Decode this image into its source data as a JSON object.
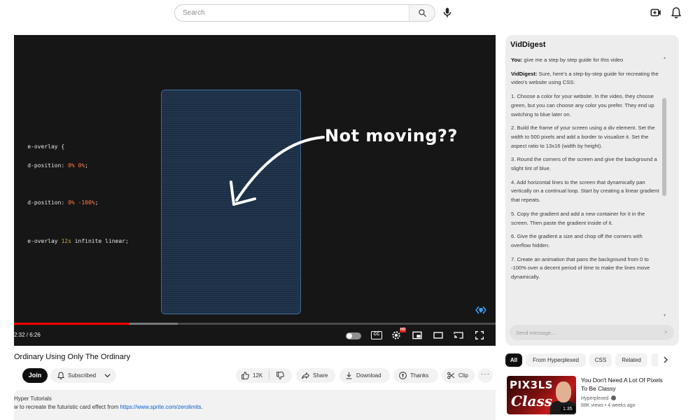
{
  "header": {
    "search_placeholder": "Search",
    "icons": [
      "search-icon",
      "mic-icon",
      "create-icon",
      "notifications-icon"
    ]
  },
  "player": {
    "code_lines": [
      {
        "selector": "e-overlay {"
      },
      {
        "prop": "d-position: ",
        "value": "0% 0%",
        "end": ";"
      },
      {
        "prop": "d-position: ",
        "value": "0% -100%",
        "end": ";"
      },
      {
        "prop": "e-overlay ",
        "value": "12s",
        "rest": " infinite linear;"
      }
    ],
    "overlay_text": "Not moving??",
    "time": "2:32 / 6:26",
    "progress_fraction": 0.24,
    "buffer_fraction": 0.34,
    "hd_badge": "HD",
    "cc_label": "CC"
  },
  "video": {
    "title": "Ordinary Using Only The Ordinary",
    "join_label": "Join",
    "subscribed_label": "Subscribed",
    "like_count": "12K",
    "share_label": "Share",
    "download_label": "Download",
    "thanks_label": "Thanks",
    "clip_label": "Clip",
    "more_label": "···",
    "description": {
      "line1": "Hyper Tutorials",
      "line2_prefix": "w to recreate the futuristic card effect from ",
      "link": "https://www.sprite.com/zerolimits",
      "line2_suffix": "."
    }
  },
  "chat": {
    "title": "VidDigest",
    "user_label": "You:",
    "user_message": " give me a step by step guide for this video",
    "bot_label": "VidDigest:",
    "bot_intro": " Sure, here's a step-by-step guide for recreating the video's website using CSS:",
    "steps": [
      "1. Choose a color for your website. In the video, they choose green, but you can choose any color you prefer. They end up switching to blue later on.",
      "2. Build the frame of your screen using a div element. Set the width to 500 pixels and add a border to visualize it. Set the aspect ratio to 13x16 (width by height).",
      "3. Round the corners of the screen and give the background a slight tint of blue.",
      "4. Add horizontal lines to the screen that dynamically pan vertically on a continual loop. Start by creating a linear gradient that repeats.",
      "5. Copy the gradient and add a new container for it in the screen. Then paste the gradient inside of it.",
      "6. Give the gradient a size and chop off the corners with overflow hidden.",
      "7. Create an animation that pans the background from 0 to -100% over a decent period of time to make the lines move dynamically."
    ],
    "input_placeholder": "Send message...",
    "send_icon": ">"
  },
  "chips": [
    "All",
    "From Hyperplexed",
    "CSS",
    "Related"
  ],
  "recommended": [
    {
      "title": "You Don't Need A Lot Of Pixels To Be Classy",
      "channel": "Hyperplexed",
      "meta": "88K views • 4 weeks ago",
      "duration": "1:35",
      "thumb_text1": "PIX3LS",
      "thumb_text2": "Class"
    }
  ]
}
